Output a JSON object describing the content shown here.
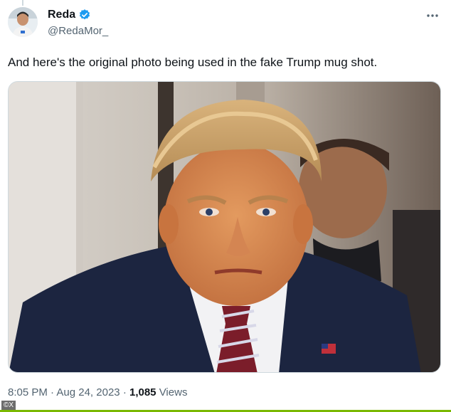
{
  "author": {
    "display_name": "Reda",
    "handle": "@RedaMor_",
    "verified": true
  },
  "tweet": {
    "text": "And here's the original photo being used in the fake Trump mug shot.",
    "time": "8:05 PM",
    "separator": "·",
    "date": "Aug 24, 2023",
    "views_count": "1,085",
    "views_label": "Views"
  },
  "watermark": "©X",
  "icons": {
    "verified": "verified-badge-icon",
    "more": "more-options-icon"
  },
  "colors": {
    "verified_blue": "#1d9bf0",
    "secondary_text": "#536471",
    "bottom_bar": "#7ab800"
  }
}
